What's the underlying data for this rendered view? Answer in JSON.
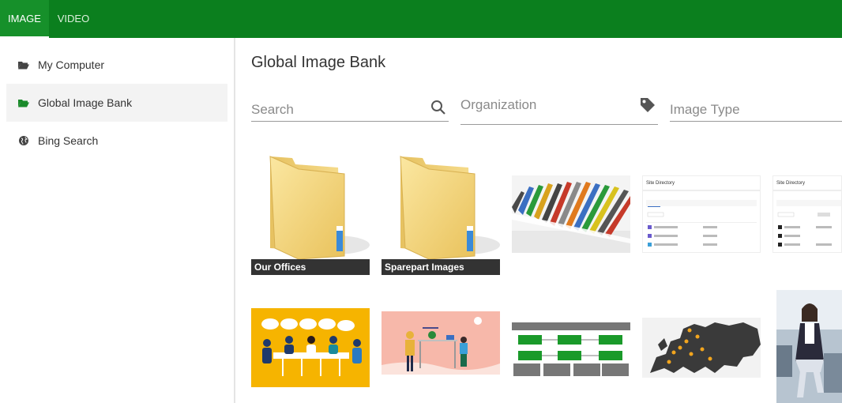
{
  "tabs": [
    {
      "label": "IMAGE"
    },
    {
      "label": "VIDEO"
    }
  ],
  "sidebar": {
    "items": [
      {
        "label": "My Computer",
        "icon": "folder-open-icon"
      },
      {
        "label": "Global Image Bank",
        "icon": "folder-open-icon",
        "active": true
      },
      {
        "label": "Bing Search",
        "icon": "globe-icon"
      }
    ]
  },
  "main": {
    "title": "Global Image Bank",
    "search": {
      "placeholder": "Search",
      "value": ""
    },
    "organization": {
      "placeholder": "Organization",
      "value": ""
    },
    "image_type": {
      "placeholder": "Image Type",
      "value": ""
    },
    "tiles": [
      {
        "type": "folder",
        "caption": "Our Offices"
      },
      {
        "type": "folder",
        "caption": "Sparepart Images"
      },
      {
        "type": "image",
        "subject": "books"
      },
      {
        "type": "image",
        "subject": "site-directory-screenshot",
        "text": "Site Directory"
      },
      {
        "type": "image",
        "subject": "site-directory-screenshot",
        "text": "Site Directory"
      },
      {
        "type": "image",
        "subject": "meeting-illustration"
      },
      {
        "type": "image",
        "subject": "office-illustration"
      },
      {
        "type": "image",
        "subject": "flowchart"
      },
      {
        "type": "image",
        "subject": "europe-map"
      },
      {
        "type": "image",
        "subject": "businesswoman-photo"
      }
    ]
  },
  "colors": {
    "brand": "#0b7f1e",
    "accent_green": "#1a8a2a",
    "folder": "#f3d77e"
  }
}
